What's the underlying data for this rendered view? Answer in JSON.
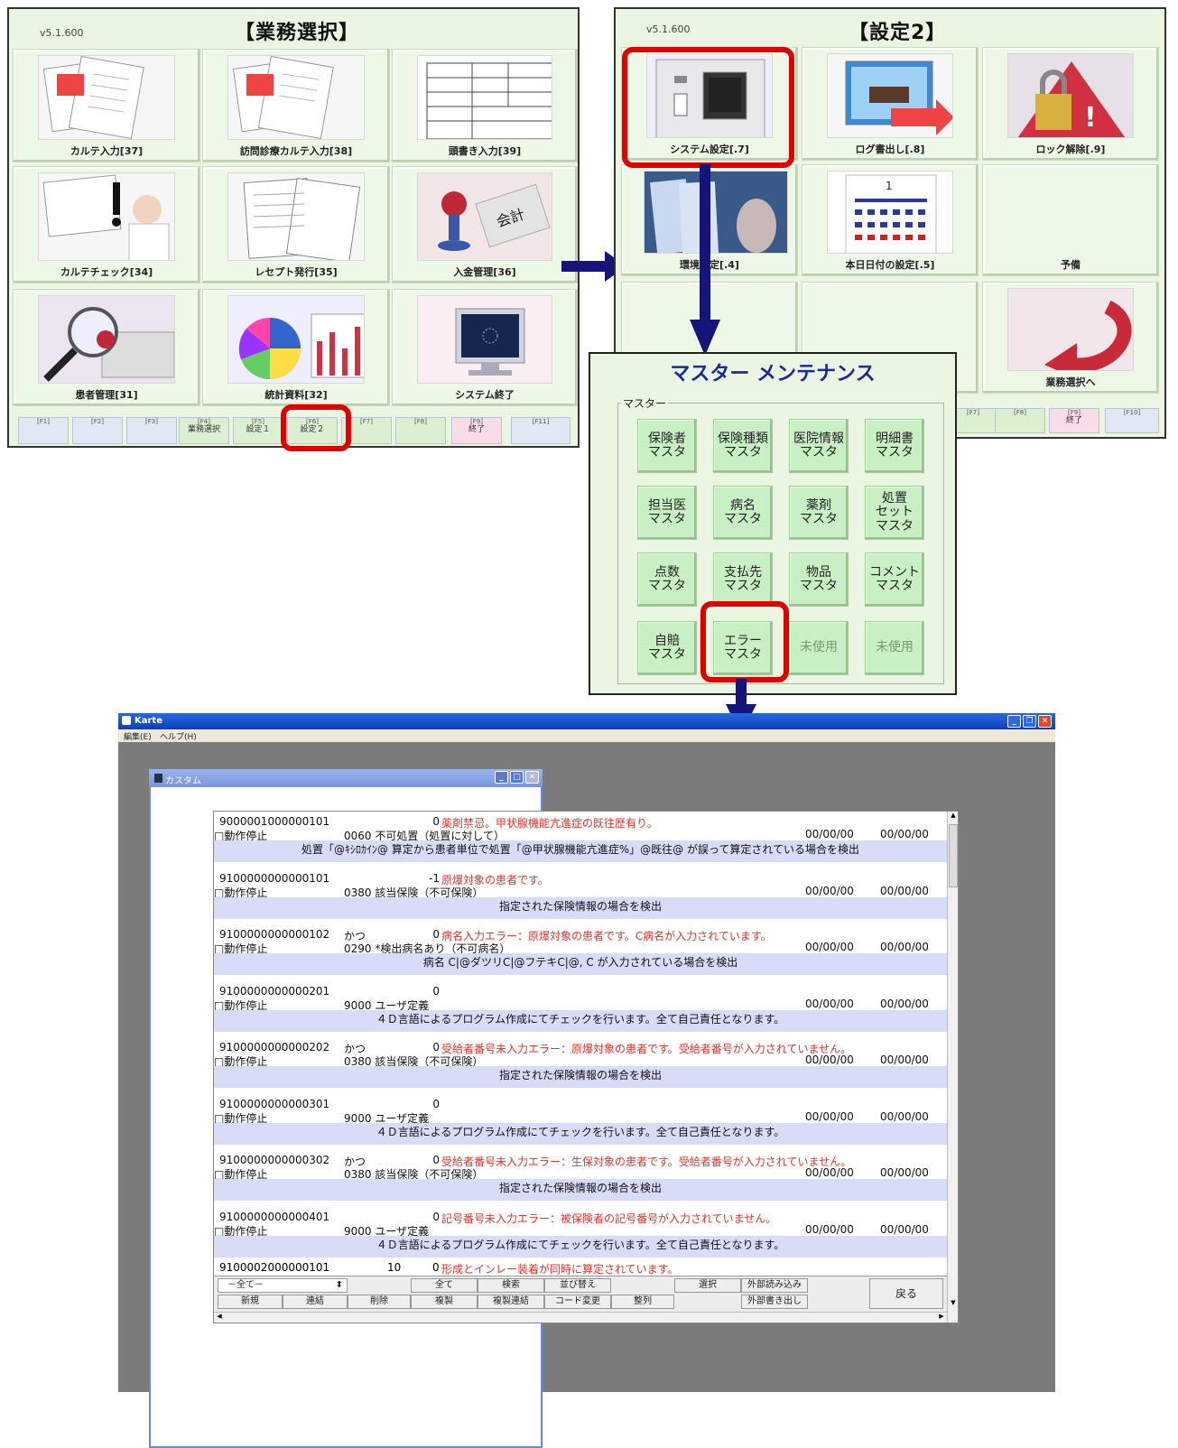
{
  "screen1": {
    "version": "v5.1.600",
    "title": "【業務選択】",
    "tiles": [
      "カルテ入力[37]",
      "訪問診療カルテ入力[38]",
      "頭書き入力[39]",
      "カルテチェック[34]",
      "レセプト発行[35]",
      "入金管理[36]",
      "患者管理[31]",
      "統計資料[32]",
      "システム終了"
    ],
    "fkeys": [
      {
        "k": "[F1]",
        "t": ""
      },
      {
        "k": "[F2]",
        "t": ""
      },
      {
        "k": "[F3]",
        "t": ""
      },
      {
        "k": "[F4]",
        "t": "業務選択"
      },
      {
        "k": "[F5]",
        "t": "設定１"
      },
      {
        "k": "[F6]",
        "t": "設定２"
      },
      {
        "k": "[F7]",
        "t": ""
      },
      {
        "k": "[F8]",
        "t": ""
      },
      {
        "k": "[F9]",
        "t": "終了"
      },
      {
        "k": "[F11]",
        "t": ""
      }
    ]
  },
  "screen2": {
    "version": "v5.1.600",
    "title": "【設定2】",
    "tiles": [
      "システム設定[.7]",
      "ログ書出し[.8]",
      "ロック解除[.9]",
      "環境設定[.4]",
      "本日日付の設定[.5]",
      "予備",
      "",
      "",
      "業務選択へ"
    ],
    "fkeys": [
      {
        "k": "[F7]",
        "t": ""
      },
      {
        "k": "[F8]",
        "t": ""
      },
      {
        "k": "[F9]",
        "t": "終了"
      },
      {
        "k": "[F10]",
        "t": ""
      }
    ],
    "calendar_day": "1"
  },
  "master": {
    "title": "マスター メンテナンス",
    "group_label": "マスター",
    "buttons": [
      "保険者\nマスタ",
      "保険種類\nマスタ",
      "医院情報\nマスタ",
      "明細書\nマスタ",
      "担当医\nマスタ",
      "病名\nマスタ",
      "薬剤\nマスタ",
      "処置\nセット\nマスタ",
      "点数\nマスタ",
      "支払先\nマスタ",
      "物品\nマスタ",
      "コメント\nマスタ",
      "自賠\nマスタ",
      "エラー\nマスタ",
      "未使用",
      "未使用"
    ]
  },
  "karte": {
    "title": "Karte",
    "menu": [
      "編集(E)",
      "ヘルプ(H)"
    ],
    "subwindow_title": "カスタム",
    "records": [
      {
        "id": "9000001000000101",
        "kana": "",
        "num": "0",
        "msg": "薬剤禁忌。甲状腺機能亢進症の既往歴有り。",
        "status": "□動作停止",
        "code": "0060 不可処置（処置に対して）",
        "d1": "00/00/00",
        "d2": "00/00/00",
        "desc": "処置「@ｷｼﾛｶｲﾝ@ 算定から患者単位で処置「@甲状腺機能亢進症%」@既往@ が誤って算定されている場合を検出"
      },
      {
        "id": "9100000000000101",
        "kana": "",
        "num": "-1",
        "msg": "原爆対象の患者です。",
        "status": "□動作停止",
        "code": "0380 該当保険（不可保険）",
        "d1": "00/00/00",
        "d2": "00/00/00",
        "desc": "指定された保険情報の場合を検出"
      },
      {
        "id": "9100000000000102",
        "kana": "かつ",
        "num": "0",
        "msg": "病名入力エラー：原爆対象の患者です。C病名が入力されています。",
        "status": "□動作停止",
        "code": "0290 *検出病名あり（不可病名）",
        "d1": "00/00/00",
        "d2": "00/00/00",
        "desc": "病名 C|@ダツリC|@フテキC|@, C が入力されている場合を検出"
      },
      {
        "id": "9100000000000201",
        "kana": "",
        "num": "0",
        "msg": "",
        "status": "□動作停止",
        "code": "9000 ユーザ定義",
        "d1": "00/00/00",
        "d2": "00/00/00",
        "desc": "４Ｄ言語によるプログラム作成にてチェックを行います。全て自己責任となります。"
      },
      {
        "id": "9100000000000202",
        "kana": "かつ",
        "num": "0",
        "msg": "受給者番号未入力エラー：原爆対象の患者です。受給者番号が入力されていません。",
        "status": "□動作停止",
        "code": "0380 該当保険（不可保険）",
        "d1": "00/00/00",
        "d2": "00/00/00",
        "desc": "指定された保険情報の場合を検出"
      },
      {
        "id": "9100000000000301",
        "kana": "",
        "num": "0",
        "msg": "",
        "status": "□動作停止",
        "code": "9000 ユーザ定義",
        "d1": "00/00/00",
        "d2": "00/00/00",
        "desc": "４Ｄ言語によるプログラム作成にてチェックを行います。全て自己責任となります。"
      },
      {
        "id": "9100000000000302",
        "kana": "かつ",
        "num": "0",
        "msg": "受給者番号未入力エラー：生保対象の患者です。受給者番号が入力されていません。",
        "status": "□動作停止",
        "code": "0380 該当保険（不可保険）",
        "d1": "00/00/00",
        "d2": "00/00/00",
        "desc": "指定された保険情報の場合を検出"
      },
      {
        "id": "9100000000000401",
        "kana": "",
        "num": "0",
        "msg": "記号番号未入力エラー：被保険者の記号番号が入力されていません。",
        "status": "□動作停止",
        "code": "9000 ユーザ定義",
        "d1": "00/00/00",
        "d2": "00/00/00",
        "desc": "４Ｄ言語によるプログラム作成にてチェックを行います。全て自己責任となります。"
      }
    ],
    "last_row": {
      "id": "9100002000000101",
      "kana": "10",
      "num": "0",
      "msg": "形成とインレー装着が同時に算定されています。"
    },
    "filter_value": "－全て－",
    "toolbar_top": [
      "全て",
      "検索",
      "並び替え",
      "選択",
      "外部読み込み"
    ],
    "toolbar_bottom": [
      "新規",
      "連結",
      "削除",
      "複製",
      "複製連結",
      "コード変更",
      "整列",
      "外部書き出し"
    ],
    "back_label": "戻る"
  }
}
